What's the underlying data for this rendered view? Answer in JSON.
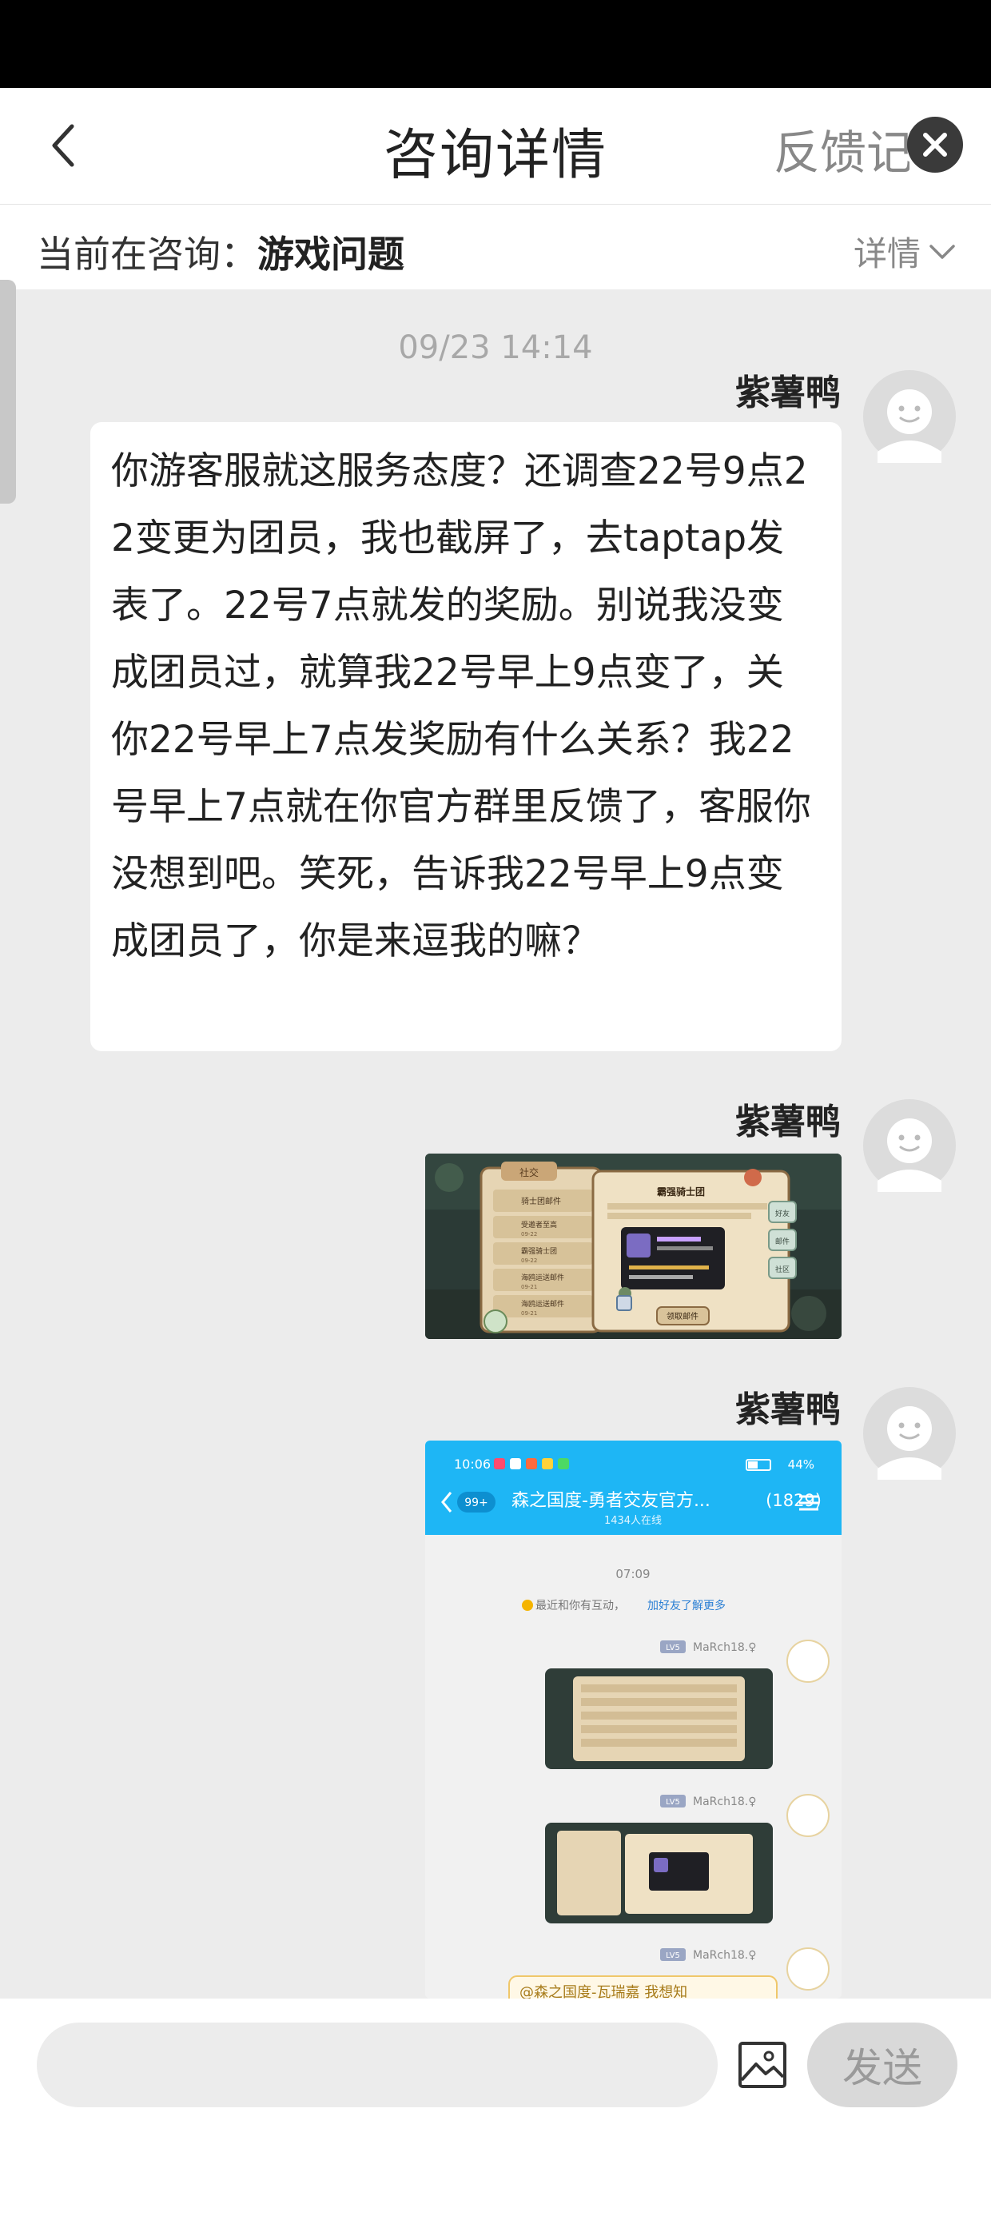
{
  "header": {
    "title": "咨询详情",
    "right_label": "反馈记录"
  },
  "topic": {
    "prefix": "当前在咨询：",
    "value": "游戏问题",
    "details_label": "详情"
  },
  "chat": {
    "timestamp": "09/23 14:14",
    "messages": [
      {
        "sender": "紫薯鸭",
        "type": "text",
        "text": "你游客服就这服务态度？还调查22号9点22变更为团员，我也截屏了，去taptap发表了。22号7点就发的奖励。别说我没变成团员过，就算我22号早上9点变了，关你22号早上7点发奖励有什么关系？我22号早上7点就在你官方群里反馈了，客服你没想到吧。笑死，告诉我22号早上9点变成团员了，你是来逗我的嘛？"
      },
      {
        "sender": "紫薯鸭",
        "type": "image",
        "screenshot": {
          "panel_title": "社交",
          "dialog_title": "霸强骑士团",
          "dialog_button": "领取邮件",
          "list_items": [
            "骑士团邮件",
            "受邀者至高",
            "霸强骑士团",
            "海鸥运送邮件",
            "海鸥运送邮件"
          ],
          "item_dates": [
            "09-22",
            "09-22",
            "09-22",
            "09-21",
            "09-21"
          ],
          "side_tabs": [
            "好友",
            "邮件",
            "社区"
          ]
        }
      },
      {
        "sender": "紫薯鸭",
        "type": "image",
        "screenshot": {
          "status_time": "10:06",
          "battery": "44%",
          "unread_badge": "99+",
          "group_title": "森之国度-勇者交友官方...",
          "group_count": "(1829)",
          "online_count": "1434人在线",
          "time_divider": "07:09",
          "notice_prefix": "最近和你有互动，",
          "notice_link": "加好友了解更多",
          "level_badge": "LV5",
          "user_name": "MaRch18.♀",
          "reply_preview": "@森之国度-瓦瑞嘉 我想知"
        }
      }
    ]
  },
  "composer": {
    "placeholder": "",
    "send_label": "发送"
  },
  "colors": {
    "background": "#ececec",
    "qq_header": "#1eb6f5",
    "send_disabled": "#d9d9d9"
  },
  "icons": [
    "back-arrow-icon",
    "close-icon",
    "chevron-down-icon",
    "avatar-placeholder-icon",
    "image-icon"
  ]
}
